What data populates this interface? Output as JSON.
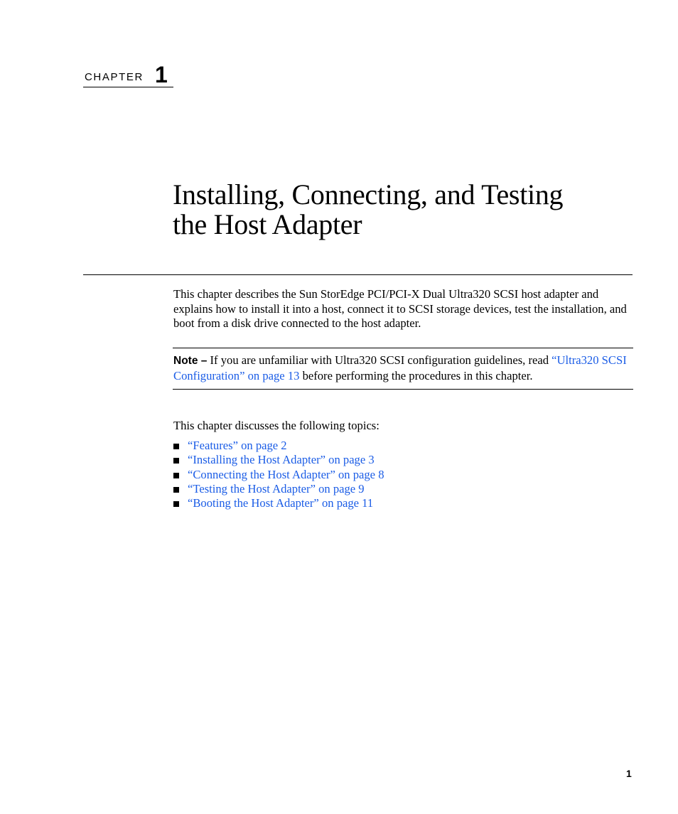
{
  "chapter": {
    "label": "CHAPTER",
    "number": "1"
  },
  "title": {
    "line1": "Installing, Connecting, and Testing",
    "line2": "the Host Adapter"
  },
  "intro_paragraph": "This chapter describes the Sun StorEdge PCI/PCI-X Dual Ultra320 SCSI host adapter and explains how to install it into a host, connect it to SCSI storage devices, test the installation, and boot from a disk drive connected to the host adapter.",
  "note": {
    "label": "Note –",
    "text_before": " If you are unfamiliar with Ultra320 SCSI configuration guidelines, read ",
    "link_text": "“Ultra320 SCSI Configuration” on page 13",
    "text_after": " before performing the procedures in this chapter."
  },
  "topics_intro": "This chapter discusses the following topics:",
  "topics": [
    {
      "label": "“Features” on page 2"
    },
    {
      "label": "“Installing the Host Adapter” on page 3"
    },
    {
      "label": "“Connecting the Host Adapter” on page 8"
    },
    {
      "label": "“Testing the Host Adapter” on page 9"
    },
    {
      "label": "“Booting the Host Adapter” on page 11"
    }
  ],
  "page_number": "1",
  "colors": {
    "link": "#1a5ce6",
    "text": "#000000"
  }
}
